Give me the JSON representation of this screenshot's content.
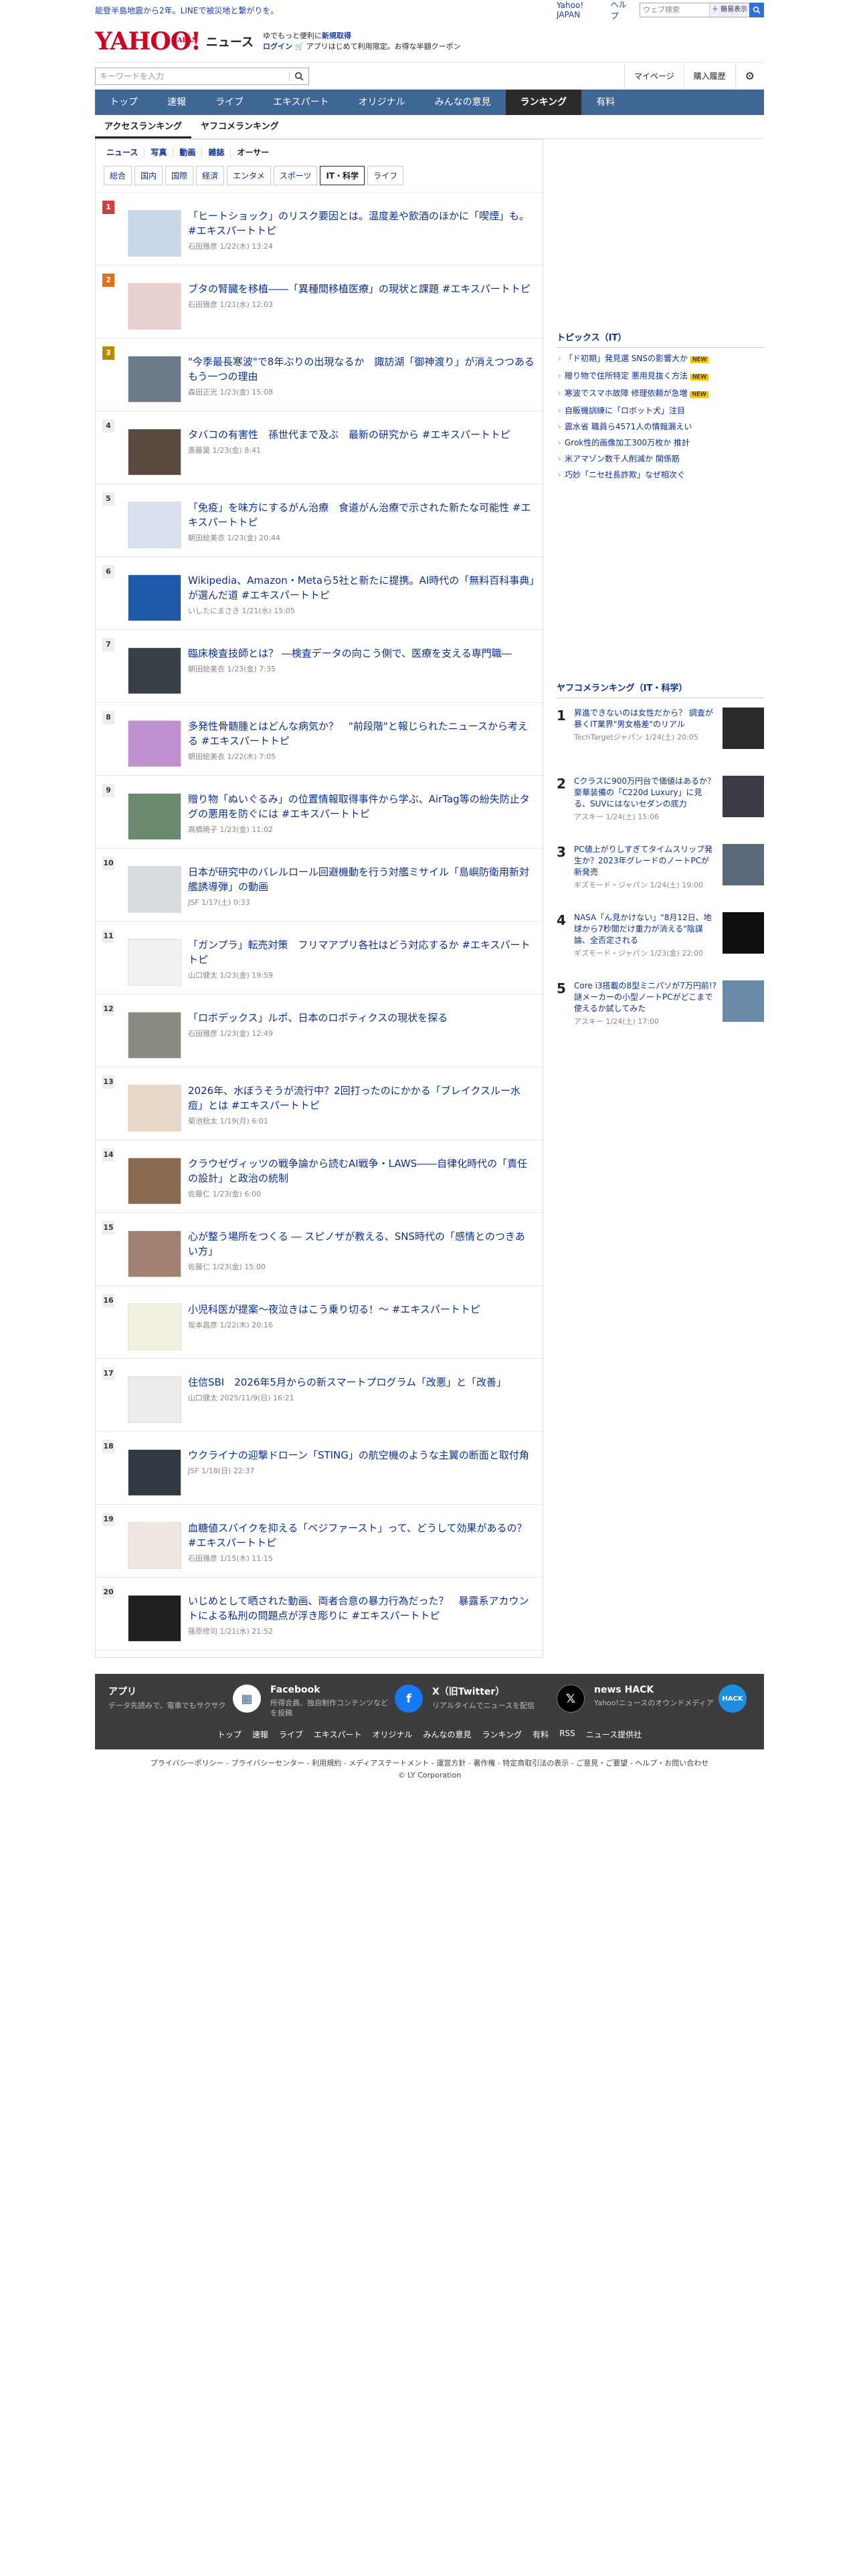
{
  "topbar": {
    "notice": "能登半島地震から2年。LINEで被災地と繋がりを。",
    "links": [
      "Yahoo! JAPAN",
      "ヘルプ"
    ],
    "search_placeholder": "ウェブ検索",
    "search_button": "＋ 簡易表示"
  },
  "header": {
    "logo": "YAHOO!",
    "logo_sub": "JAPAN",
    "brand": "ニュース",
    "promo_line1_a": "ゆでもっと便利に",
    "promo_line1_b": "新規取得",
    "promo_line2_a": "ログイン",
    "promo_line2_b": "アプリはじめて利用限定。お得な半額クーポン"
  },
  "util": {
    "search_placeholder": "キーワードを入力",
    "mypage": "マイページ",
    "history": "購入履歴"
  },
  "nav": [
    "トップ",
    "速報",
    "ライブ",
    "エキスパート",
    "オリジナル",
    "みんなの意見",
    "ランキング",
    "有料"
  ],
  "subtabs": [
    "アクセスランキング",
    "ヤフコメランキング"
  ],
  "cats1": [
    "ニュース",
    "写真",
    "動画",
    "雑誌",
    "オーサー"
  ],
  "cats2": [
    "総合",
    "国内",
    "国際",
    "経済",
    "エンタメ",
    "スポーツ",
    "IT・科学",
    "ライフ"
  ],
  "items": [
    {
      "rank": "1",
      "title": "「ヒートショック」のリスク要因とは。温度差や飲酒のほかに「喫煙」も。 #エキスパートトピ",
      "meta": "石田雅彦  1/22(木) 13:24"
    },
    {
      "rank": "2",
      "title": "ブタの腎臓を移植――「異種間移植医療」の現状と課題 #エキスパートトピ",
      "meta": "石田雅彦  1/21(水) 12:03"
    },
    {
      "rank": "3",
      "title": "\"今季最長寒波\"で8年ぶりの出現なるか　諏訪湖「御神渡り」が消えつつあるもう一つの理由",
      "meta": "森田正光  1/23(金) 15:08"
    },
    {
      "rank": "4",
      "title": "タバコの有害性　孫世代まで及ぶ　最新の研究から #エキスパートトピ",
      "meta": "斎藤葉  1/23(金) 8:41"
    },
    {
      "rank": "5",
      "title": "「免疫」を味方にするがん治療　食道がん治療で示された新たな可能性 #エキスパートトピ",
      "meta": "朝田絵美衣  1/23(金) 20:44"
    },
    {
      "rank": "6",
      "title": "Wikipedia、Amazon・Metaら5社と新たに提携。AI時代の「無料百科事典」が選んだ道 #エキスパートトピ",
      "meta": "いしたにまさき  1/21(水) 15:05"
    },
    {
      "rank": "7",
      "title": "臨床検査技師とは？ ―検査データの向こう側で、医療を支える専門職―",
      "meta": "朝田絵美衣  1/23(金) 7:35"
    },
    {
      "rank": "8",
      "title": "多発性骨髄腫とはどんな病気か？　\"前段階\"と報じられたニュースから考える #エキスパートトピ",
      "meta": "朝田絵美衣  1/22(木) 7:05"
    },
    {
      "rank": "9",
      "title": "贈り物「ぬいぐるみ」の位置情報取得事件から学ぶ、AirTag等の紛失防止タグの悪用を防ぐには #エキスパートトピ",
      "meta": "高橋暁子  1/23(金) 11:02"
    },
    {
      "rank": "10",
      "title": "日本が研究中のバレルロール回避機動を行う対艦ミサイル「島嶼防衛用新対艦誘導弾」の動画",
      "meta": "JSF  1/17(土) 0:33"
    },
    {
      "rank": "11",
      "title": "「ガンプラ」転売対策　フリマアプリ各社はどう対応するか #エキスパートトピ",
      "meta": "山口健太  1/23(金) 19:59"
    },
    {
      "rank": "12",
      "title": "「ロボデックス」ルポ、日本のロボティクスの現状を探る",
      "meta": "石田雅彦  1/23(金) 12:49"
    },
    {
      "rank": "13",
      "title": "2026年、水ぼうそうが流行中？2回打ったのにかかる「ブレイクスルー水痘」とは #エキスパートトピ",
      "meta": "菊池稔太  1/19(月) 6:01"
    },
    {
      "rank": "14",
      "title": "クラウゼヴィッツの戦争論から読むAI戦争・LAWS――自律化時代の「責任の設計」と政治の統制",
      "meta": "佐藤仁  1/23(金) 6:00"
    },
    {
      "rank": "15",
      "title": "心が整う場所をつくる ― スピノザが教える、SNS時代の「感情とのつきあい方」",
      "meta": "佐藤仁  1/23(金) 15:00"
    },
    {
      "rank": "16",
      "title": "小児科医が提案〜夜泣きはこう乗り切る！〜 #エキスパートトピ",
      "meta": "坂本昌彦  1/22(木) 20:16"
    },
    {
      "rank": "17",
      "title": "住信SBI　2026年5月からの新スマートプログラム「改悪」と「改善」",
      "meta": "山口健太  2025/11/9(日) 16:21"
    },
    {
      "rank": "18",
      "title": "ウクライナの迎撃ドローン「STING」の航空機のような主翼の断面と取付角",
      "meta": "JSF  1/18(日) 22:37"
    },
    {
      "rank": "19",
      "title": "血糖値スパイクを抑える「ベジファースト」って、どうして効果があるの？ #エキスパートトピ",
      "meta": "石田雅彦  1/15(木) 11:15"
    },
    {
      "rank": "20",
      "title": "いじめとして晒された動画、両者合意の暴力行為だった？　暴露系アカウントによる私刑の問題点が浮き彫りに #エキスパートトピ",
      "meta": "篠原修司  1/21(水) 21:52"
    }
  ],
  "topics": {
    "heading": "トピックス（IT）",
    "new_label": "NEW",
    "list": [
      {
        "text": "「ド初期」発見選 SNSの影響大か",
        "new": true
      },
      {
        "text": "贈り物で住所特定 悪用見抜く方法",
        "new": true
      },
      {
        "text": "寒波でスマホ故障 修理依頼が急増",
        "new": true
      },
      {
        "text": "自販機訓練に「ロボット犬」注目",
        "new": false
      },
      {
        "text": "震水省 職員ら4571人の情報漏えい",
        "new": false
      },
      {
        "text": "Grok性的画像加工300万枚か 推計",
        "new": false
      },
      {
        "text": "米アマゾン数千人削減か 関係筋",
        "new": false
      },
      {
        "text": "巧妙「ニセ社長詐欺」なぜ相次ぐ",
        "new": false
      }
    ]
  },
  "yrank": {
    "heading": "ヤフコメランキング（IT・科学）",
    "list": [
      {
        "n": "1",
        "text": "昇進できないのは女性だから？ 調査が暴くIT業界\"男女格差\"のリアル",
        "meta": "TechTargetジャパン 1/24(土) 20:05"
      },
      {
        "n": "2",
        "text": "Cクラスに900万円台で価値はあるか？ 豪華装備の「C220d Luxury」に見る、SUVにはないセダンの底力",
        "meta": "アスキー 1/24(土) 15:06"
      },
      {
        "n": "3",
        "text": "PC値上がりしすぎてタイムスリップ発生か？2023年グレードのノートPCが新発売",
        "meta": "ギズモード・ジャパン 1/24(土) 19:00"
      },
      {
        "n": "4",
        "text": "NASA「ん見かけない」\"8月12日、地球から7秒間だけ重力が消える\"陰謀論、全否定される",
        "meta": "ギズモード・ジャパン 1/23(金) 22:00"
      },
      {
        "n": "5",
        "text": "Core i3搭載の8型ミニパソが7万円前!?謎メーカーの小型ノートPCがどこまで使えるか試してみた",
        "meta": "アスキー 1/24(土) 17:00"
      }
    ]
  },
  "footer": {
    "cards": [
      {
        "title": "アプリ",
        "desc": "データ先読みで、電車でもサクサク"
      },
      {
        "title": "Facebook",
        "desc": "所得会員、独自制作コンテンツなどを投稿"
      },
      {
        "title": "X（旧Twitter）",
        "desc": "リアルタイムでニュースを配信"
      },
      {
        "title": "news HACK",
        "desc": "Yahoo!ニュースのオウンドメディア"
      }
    ],
    "links": [
      "トップ",
      "速報",
      "ライブ",
      "エキスパート",
      "オリジナル",
      "みんなの意見",
      "ランキング",
      "有料",
      "RSS",
      "ニュース提供社"
    ],
    "legal": "プライバシーポリシー - プライバシーセンター - 利用規約 - メディアステートメント - 運営方針 - 著作権 - 特定商取引法の表示 - ご意見・ご要望 - ヘルプ・お問い合わせ",
    "copyright": "© LY Corporation"
  }
}
